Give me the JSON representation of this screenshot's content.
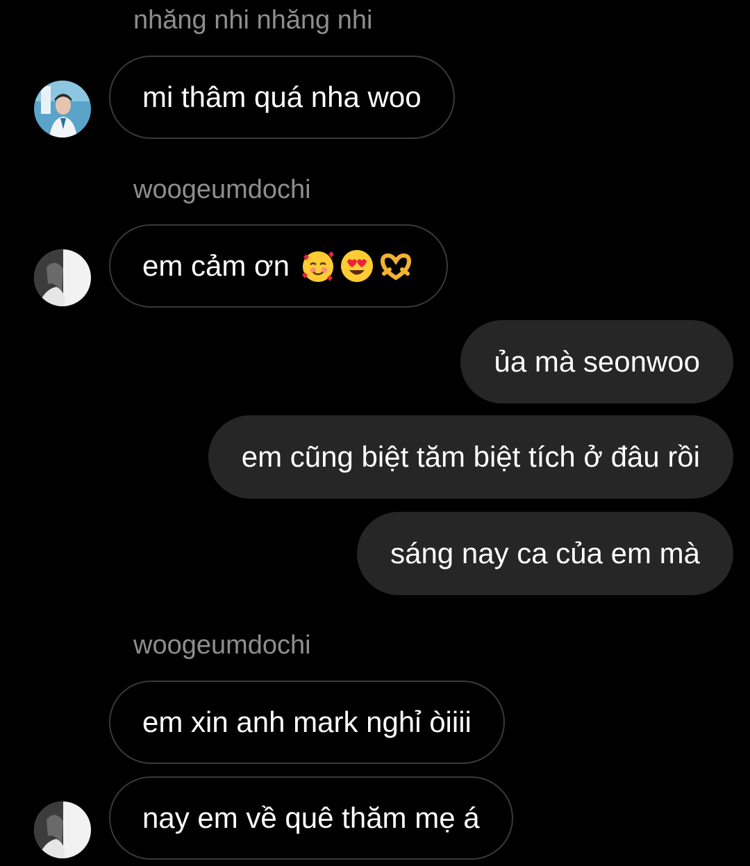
{
  "thread": {
    "messages": [
      {
        "sender": "nhăng nhi nhăng nhi",
        "text": "mi thâm quá nha woo"
      },
      {
        "sender": "woogeumdochi",
        "text": "em cảm ơn",
        "emojis": [
          "smiling-face-with-hearts-emoji",
          "heart-eyes-emoji",
          "heart-hands-emoji"
        ]
      },
      {
        "text": "ủa mà seonwoo"
      },
      {
        "text": "em cũng biệt tăm biệt tích ở đâu rồi"
      },
      {
        "text": "sáng nay ca của em mà"
      },
      {
        "sender": "woogeumdochi",
        "text": "em xin anh mark nghỉ òiiii"
      },
      {
        "text": "nay em về quê thăm mẹ á"
      }
    ]
  },
  "colors": {
    "background": "#000000",
    "incoming_border": "#3a3a3a",
    "outgoing_bubble": "#262626",
    "sender_name": "#8e8e8e",
    "text": "#ffffff"
  }
}
